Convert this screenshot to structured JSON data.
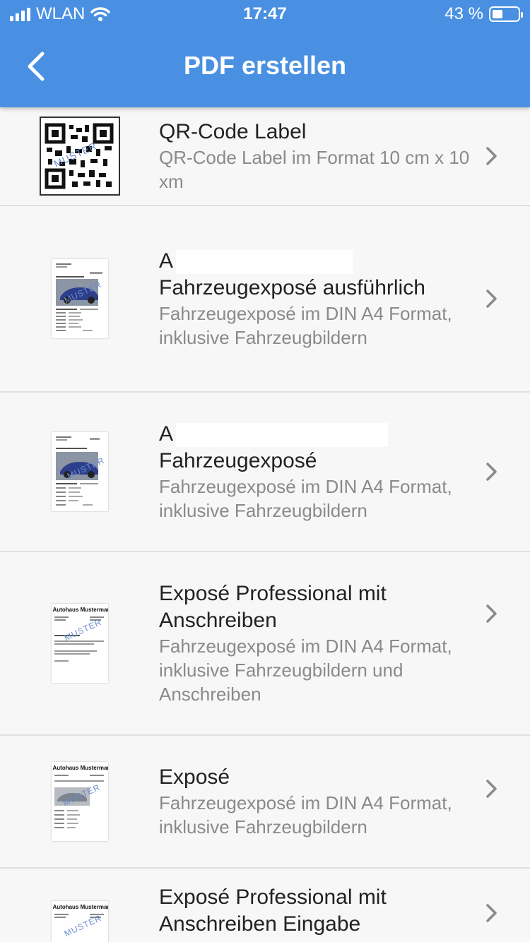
{
  "status": {
    "carrier": "WLAN",
    "time": "17:47",
    "battery": "43 %"
  },
  "nav": {
    "title": "PDF erstellen"
  },
  "items": [
    {
      "title": "QR-Code Label",
      "subtitle": "QR-Code Label im Format  10 cm x 10 xm",
      "thumb": "qr-code-icon"
    },
    {
      "title_prefix": "A",
      "title": "Fahrzeugexposé ausführlich",
      "subtitle": "Fahrzeugexposé im DIN A4 Format, inklusive Fahrzeugbildern",
      "thumb": "document-with-car-icon"
    },
    {
      "title_prefix": "A",
      "title": "Fahrzeugexposé",
      "subtitle": "Fahrzeugexposé im DIN A4 Format, inklusive Fahrzeugbildern",
      "thumb": "document-with-car-icon"
    },
    {
      "title": "Exposé Professional mit Anschreiben",
      "subtitle": "Fahrzeugexposé im DIN A4 Format, inklusive Fahrzeugbildern und Anschreiben",
      "thumb": "letter-document-icon"
    },
    {
      "title": "Exposé",
      "subtitle": "Fahrzeugexposé im DIN A4 Format, inklusive Fahrzeugbildern",
      "thumb": "document-with-car-icon"
    },
    {
      "title": "Exposé Professional mit Anschreiben Eingabe",
      "subtitle": "",
      "thumb": "letter-document-icon"
    }
  ],
  "thumb_texts": {
    "muster": "MUSTER",
    "company": "Autohaus Mustermann"
  },
  "colors": {
    "header": "#4a90e2",
    "background": "#f2f2f2",
    "subtitle": "#8a8a8a"
  }
}
